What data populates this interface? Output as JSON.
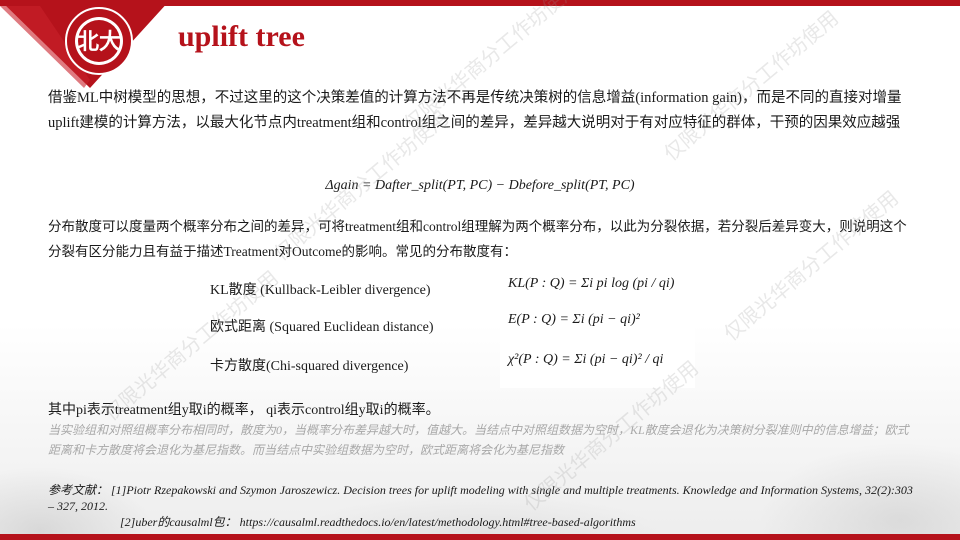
{
  "header": {
    "title": "uplift tree"
  },
  "content": {
    "paragraph1": "借鉴ML中树模型的思想，不过这里的这个决策差值的计算方法不再是传统决策树的信息增益(information gain)，而是不同的直接对增量uplift建模的计算方法，以最大化节点内treatment组和control组之间的差异，差异越大说明对于有对应特征的群体，干预的因果效应越强",
    "formula_gain": "Δgain = Dafter_split(PT, PC) − Dbefore_split(PT, PC)",
    "paragraph2": "分布散度可以度量两个概率分布之间的差异，可将treatment组和control组理解为两个概率分布，以此为分裂依据，若分裂后差异变大，则说明这个分裂有区分能力且有益于描述Treatment对Outcome的影响。常见的分布散度有：",
    "divergences": [
      {
        "label": "KL散度 (Kullback-Leibler divergence)",
        "formula": "KL(P : Q) = Σi pi log (pi / qi)"
      },
      {
        "label": "欧式距离 (Squared Euclidean distance)",
        "formula": "E(P : Q) = Σi (pi − qi)²"
      },
      {
        "label": "卡方散度(Chi-squared divergence)",
        "formula": "χ²(P : Q) = Σi (pi − qi)² / qi"
      }
    ],
    "paragraph3": "其中pi表示treatment组y取i的概率， qi表示control组y取i的概率。",
    "paragraph4": "当实验组和对照组概率分布相同时，散度为0，当概率分布差异越大时，值越大。当结点中对照组数据为空时，KL散度会退化为决策树分裂准则中的信息增益；欧式距离和卡方散度将会退化为基尼指数。而当结点中实验组数据为空时，欧式距离将会化为基尼指数"
  },
  "references": {
    "ref1": "参考文献： [1]Piotr Rzepakowski and Szymon Jaroszewicz. Decision trees for uplift modeling with single and multiple treatments. Knowledge and Information Systems, 32(2):303 – 327, 2012.",
    "ref2": "[2]uber的causalml包： https://causalml.readthedocs.io/en/latest/methodology.html#tree-based-algorithms"
  },
  "watermarks": [
    "仅限光华商分工作坊使用",
    "仅限光华商分工作坊使用",
    "仅限光华商分工作坊使用",
    "仅限光华商分工作坊使用",
    "仅限光华商分工作坊使用",
    "仅限光华商分工作坊使用"
  ],
  "colors": {
    "brand_red": "#b5121b",
    "faint_text": "#a8a8a8"
  }
}
